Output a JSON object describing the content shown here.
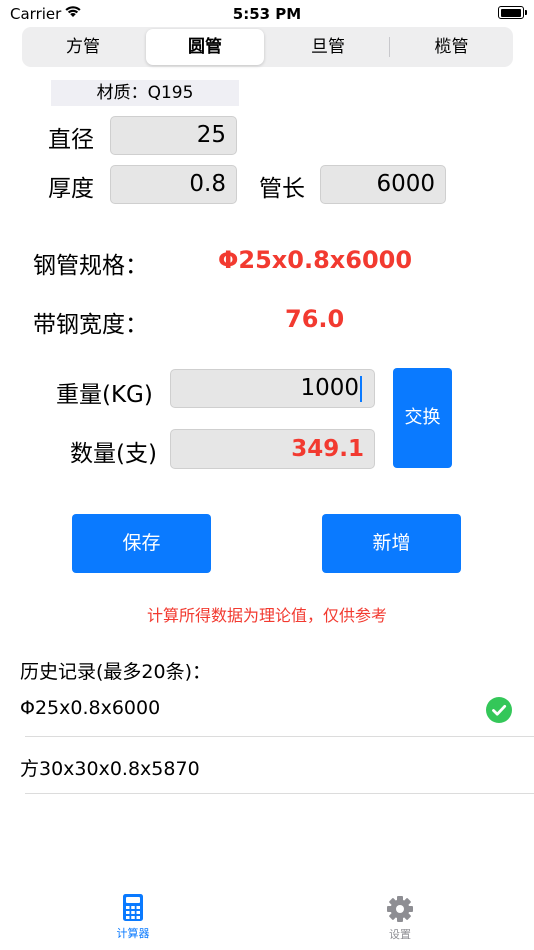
{
  "status_bar": {
    "carrier": "Carrier",
    "time": "5:53 PM"
  },
  "segments": [
    {
      "label": "方管",
      "active": false
    },
    {
      "label": "圆管",
      "active": true
    },
    {
      "label": "旦管",
      "active": false
    },
    {
      "label": "榄管",
      "active": false
    }
  ],
  "material": "材质：Q195",
  "inputs": {
    "diameter_label": "直径",
    "diameter_value": "25",
    "thickness_label": "厚度",
    "thickness_value": "0.8",
    "length_label": "管长",
    "length_value": "6000"
  },
  "results": {
    "spec_label": "钢管规格：",
    "spec_value": "Φ25x0.8x6000",
    "strip_width_label": "带钢宽度：",
    "strip_width_value": "76.0"
  },
  "calc": {
    "weight_label": "重量(KG)",
    "weight_value": "1000",
    "quantity_label": "数量(支)",
    "quantity_value": "349.1",
    "swap_label": "交换"
  },
  "actions": {
    "save_label": "保存",
    "add_label": "新增"
  },
  "notice": "计算所得数据为理论值，仅供参考",
  "history": {
    "title": "历史记录(最多20条)：",
    "items": [
      {
        "text": "Φ25x0.8x6000",
        "selected": true
      },
      {
        "text": "方30x30x0.8x5870",
        "selected": false
      }
    ]
  },
  "tab_bar": {
    "items": [
      {
        "label": "计算器",
        "icon": "calculator-icon",
        "active": true
      },
      {
        "label": "设置",
        "icon": "gear-icon",
        "active": false
      }
    ]
  },
  "colors": {
    "accent": "#0A7AFF",
    "result_red": "#F23A30",
    "inactive_tab": "#8E8E93",
    "success": "#34C759"
  }
}
